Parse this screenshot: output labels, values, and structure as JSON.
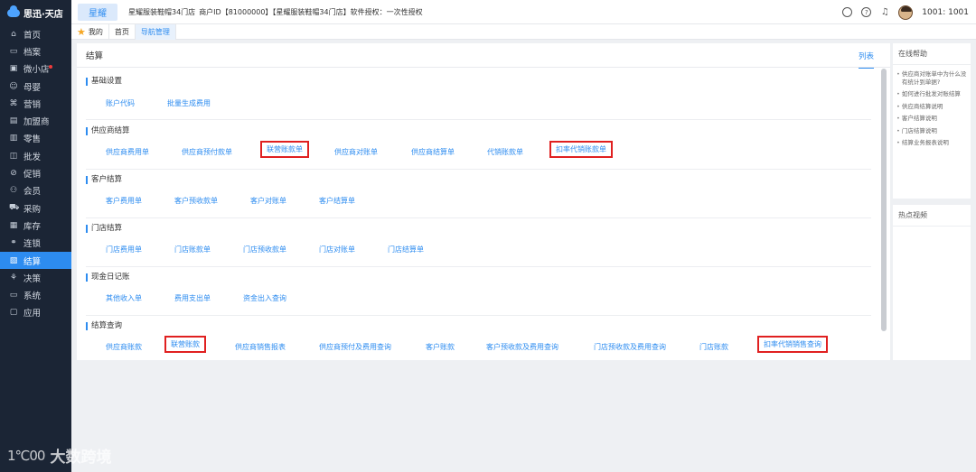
{
  "app": {
    "logo_text": "思迅·天店"
  },
  "sidebar": {
    "items": [
      {
        "icon": "home-icon",
        "glyph": "⌂",
        "label": "首页"
      },
      {
        "icon": "folder-icon",
        "glyph": "▭",
        "label": "档案"
      },
      {
        "icon": "shop-icon",
        "glyph": "▣",
        "label": "微小店",
        "badge": true
      },
      {
        "icon": "baby-icon",
        "glyph": "☺",
        "label": "母婴"
      },
      {
        "icon": "marketing-icon",
        "glyph": "⌘",
        "label": "营销"
      },
      {
        "icon": "franchise-icon",
        "glyph": "▤",
        "label": "加盟商"
      },
      {
        "icon": "retail-icon",
        "glyph": "▥",
        "label": "零售"
      },
      {
        "icon": "wholesale-icon",
        "glyph": "◫",
        "label": "批发"
      },
      {
        "icon": "promotion-icon",
        "glyph": "⊘",
        "label": "促销"
      },
      {
        "icon": "member-icon",
        "glyph": "⚇",
        "label": "会员"
      },
      {
        "icon": "purchase-icon",
        "glyph": "⛟",
        "label": "采购"
      },
      {
        "icon": "stock-icon",
        "glyph": "▦",
        "label": "库存"
      },
      {
        "icon": "chain-icon",
        "glyph": "⚭",
        "label": "连锁"
      },
      {
        "icon": "settlement-icon",
        "glyph": "▧",
        "label": "结算",
        "active": true
      },
      {
        "icon": "decision-icon",
        "glyph": "⚘",
        "label": "决策"
      },
      {
        "icon": "system-icon",
        "glyph": "▭",
        "label": "系统"
      },
      {
        "icon": "apps-icon",
        "glyph": "▢",
        "label": "应用"
      }
    ]
  },
  "watermark": {
    "mark": "1℃00",
    "text": "大数跨境"
  },
  "topbar": {
    "brand_label": "星耀",
    "store_name": "星耀服装鞋帽34门店",
    "merchant_id": "商户ID【81000000】【星耀服装鞋帽34门店】软件授权：一次性授权",
    "user": "1001: 1001"
  },
  "tabs": [
    {
      "label": "我的",
      "icon": "star-icon"
    },
    {
      "label": "首页"
    },
    {
      "label": "导航管理",
      "active": true
    }
  ],
  "main": {
    "title": "结算",
    "view_tab": "列表",
    "sections": [
      {
        "title": "基础设置",
        "links": [
          "账户代码",
          "批量生成费用"
        ]
      },
      {
        "title": "供应商结算",
        "links": [
          "供应商费用单",
          "供应商预付款单",
          "联营账款单",
          "供应商对账单",
          "供应商结算单",
          "代销账款单",
          "扣率代销账款单"
        ]
      },
      {
        "title": "客户结算",
        "links": [
          "客户费用单",
          "客户预收款单",
          "客户对账单",
          "客户结算单"
        ]
      },
      {
        "title": "门店结算",
        "links": [
          "门店费用单",
          "门店账款单",
          "门店预收款单",
          "门店对账单",
          "门店结算单"
        ]
      },
      {
        "title": "现金日记账",
        "links": [
          "其他收入单",
          "费用支出单",
          "资金出入查询"
        ]
      },
      {
        "title": "结算查询",
        "links": [
          "供应商账款",
          "联营账款",
          "供应商销售报表",
          "供应商预付及费用查询",
          "客户账款",
          "客户预收款及费用查询",
          "门店预收款及费用查询",
          "门店账款",
          "扣率代销销售查询"
        ]
      }
    ]
  },
  "help_panel": {
    "title": "在线帮助",
    "items": [
      "供应商对账单中为什么没有统计到单据?",
      "如何进行批发对账结算",
      "供应商结算说明",
      "客户结算说明",
      "门店结算说明",
      "结算业务报表说明"
    ]
  },
  "video_panel": {
    "title": "热点视频"
  },
  "colors": {
    "accent": "#2d8cf0",
    "sidebar_bg": "#1b2535",
    "highlight_box": "#e02020"
  }
}
